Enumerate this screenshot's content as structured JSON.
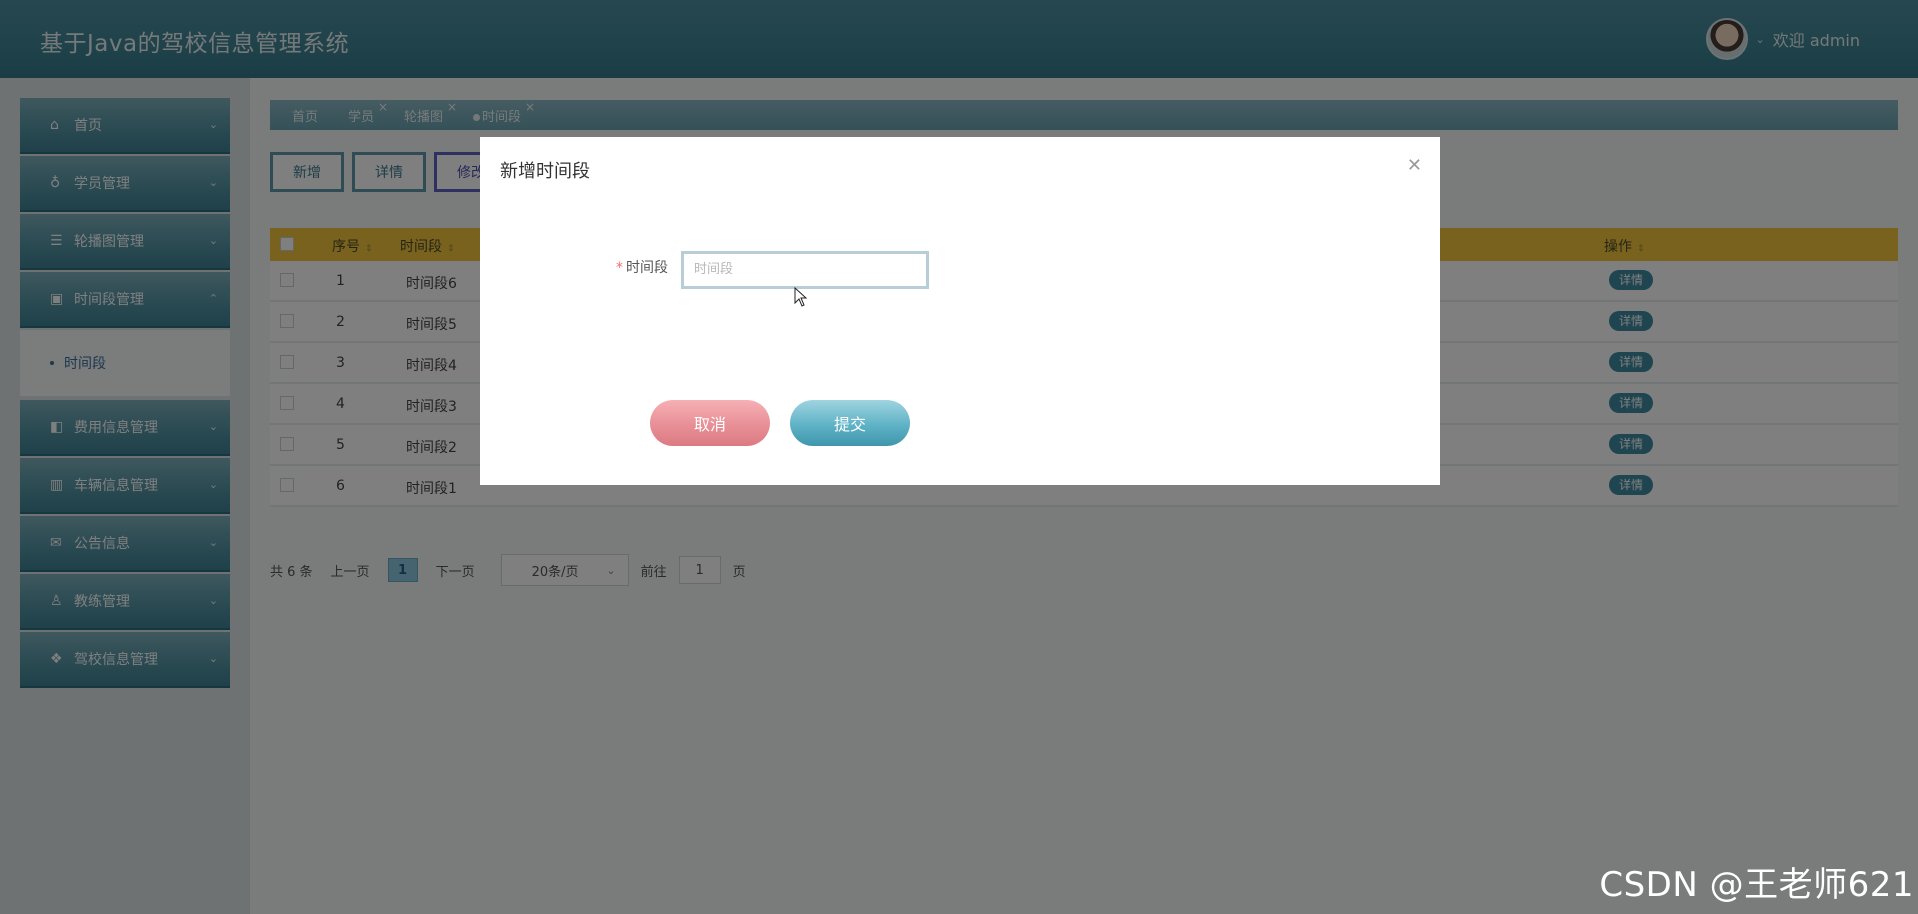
{
  "app": {
    "title": "基于Java的驾校信息管理系统",
    "welcome": "欢迎 admin"
  },
  "sidebar": {
    "items": [
      {
        "label": "首页",
        "icon": "home-icon"
      },
      {
        "label": "学员管理",
        "icon": "badge-icon"
      },
      {
        "label": "轮播图管理",
        "icon": "list-icon"
      },
      {
        "label": "时间段管理",
        "icon": "contact-icon"
      },
      {
        "label": "费用信息管理",
        "icon": "panel-icon"
      },
      {
        "label": "车辆信息管理",
        "icon": "chart-icon"
      },
      {
        "label": "公告信息",
        "icon": "mail-icon"
      },
      {
        "label": "教练管理",
        "icon": "user-icon"
      },
      {
        "label": "驾校信息管理",
        "icon": "grid-icon"
      }
    ],
    "sub_item": "时间段"
  },
  "tabs": [
    {
      "label": "首页"
    },
    {
      "label": "学员"
    },
    {
      "label": "轮播图"
    },
    {
      "label": "时间段"
    }
  ],
  "toolbar": {
    "add": "新增",
    "detail": "详情",
    "edit": "修改"
  },
  "table": {
    "columns": [
      "序号",
      "时间段",
      "操作"
    ],
    "rows": [
      {
        "index": "1",
        "period": "时间段6",
        "action": "详情"
      },
      {
        "index": "2",
        "period": "时间段5",
        "action": "详情"
      },
      {
        "index": "3",
        "period": "时间段4",
        "action": "详情"
      },
      {
        "index": "4",
        "period": "时间段3",
        "action": "详情"
      },
      {
        "index": "5",
        "period": "时间段2",
        "action": "详情"
      },
      {
        "index": "6",
        "period": "时间段1",
        "action": "详情"
      }
    ]
  },
  "pager": {
    "total": "共 6 条",
    "prev": "上一页",
    "page": "1",
    "next": "下一页",
    "size": "20条/页",
    "goto": "前往",
    "goto_value": "1",
    "unit": "页"
  },
  "dialog": {
    "title": "新增时间段",
    "field_label": "时间段",
    "field_required": "*",
    "field_placeholder": "时间段",
    "cancel": "取消",
    "submit": "提交"
  },
  "watermark": "CSDN @王老师621"
}
